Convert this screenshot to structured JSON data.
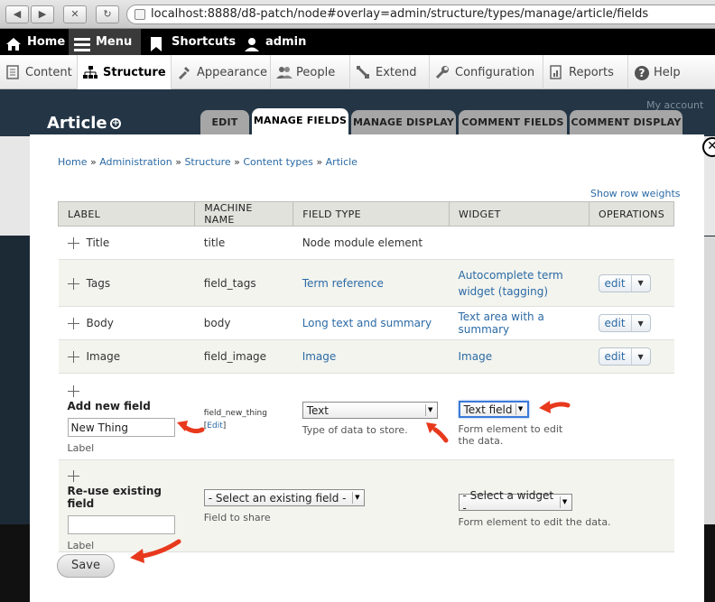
{
  "browser": {
    "url": "localhost:8888/d8-patch/node#overlay=admin/structure/types/manage/article/fields"
  },
  "toolbar": {
    "home": "Home",
    "menu": "Menu",
    "shortcuts": "Shortcuts",
    "user": "admin"
  },
  "tray": {
    "items": [
      "Content",
      "Structure",
      "Appearance",
      "People",
      "Extend",
      "Configuration",
      "Reports",
      "Help"
    ]
  },
  "background": {
    "page_title": "Article",
    "my_account": "My account",
    "tabs": [
      "EDIT",
      "MANAGE FIELDS",
      "MANAGE DISPLAY",
      "COMMENT FIELDS",
      "COMMENT DISPLAY"
    ]
  },
  "breadcrumb": [
    "Home",
    "Administration",
    "Structure",
    "Content types",
    "Article"
  ],
  "breadcrumb_sep": "»",
  "show_row_weights": "Show row weights",
  "table": {
    "headers": [
      "LABEL",
      "MACHINE NAME",
      "FIELD TYPE",
      "WIDGET",
      "OPERATIONS"
    ],
    "rows": [
      {
        "label": "Title",
        "machine": "title",
        "type": "Node module element",
        "widget": "",
        "op": ""
      },
      {
        "label": "Tags",
        "machine": "field_tags",
        "type": "Term reference",
        "widget": "Autocomplete term widget (tagging)",
        "op": "edit"
      },
      {
        "label": "Body",
        "machine": "body",
        "type": "Long text and summary",
        "widget": "Text area with a summary",
        "op": "edit"
      },
      {
        "label": "Image",
        "machine": "field_image",
        "type": "Image",
        "widget": "Image",
        "op": "edit"
      }
    ]
  },
  "add_new": {
    "title": "Add new field",
    "label_value": "New Thing",
    "label_caption": "Label",
    "machine_name": "field_new_thing",
    "machine_edit": "Edit",
    "type_value": "Text",
    "type_caption": "Type of data to store.",
    "widget_value": "Text field",
    "widget_caption": "Form element to edit the data."
  },
  "reuse": {
    "title": "Re-use existing field",
    "label_value": "",
    "label_caption": "Label",
    "field_select": "- Select an existing field -",
    "field_caption": "Field to share",
    "widget_select": "- Select a widget -",
    "widget_caption": "Form element to edit the data."
  },
  "save_label": "Save",
  "colors": {
    "link": "#2b6aa5",
    "annotation_arrow": "#e8391d"
  }
}
